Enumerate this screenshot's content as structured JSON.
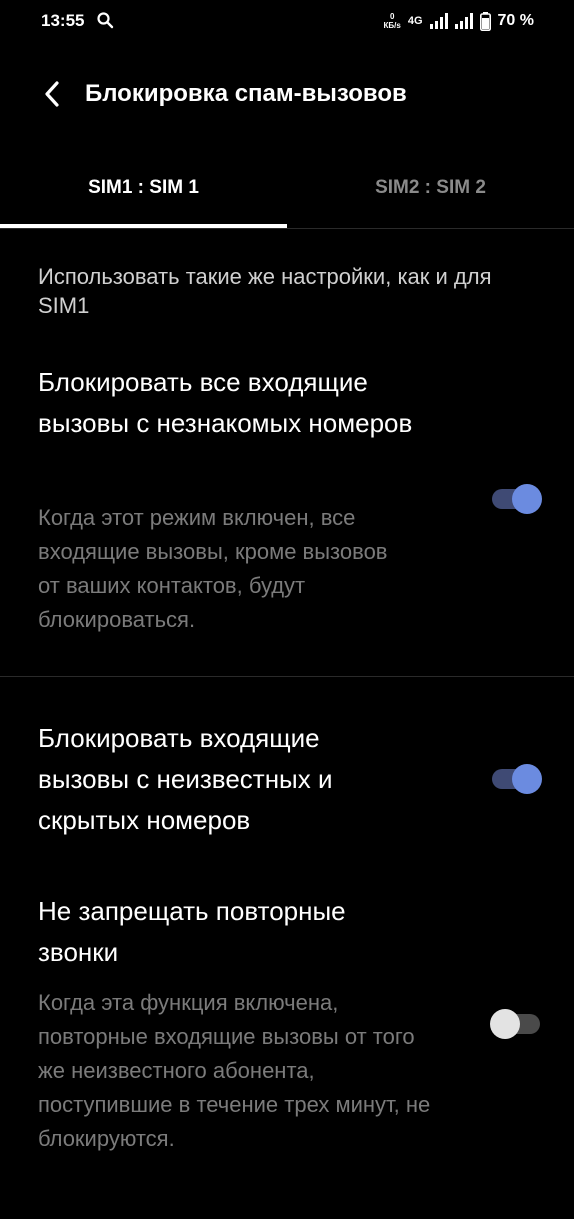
{
  "status_bar": {
    "time": "13:55",
    "speed_value": "0",
    "speed_unit": "КБ/s",
    "network_type": "4G",
    "battery_percent": "70 %"
  },
  "header": {
    "title": "Блокировка спам-вызовов"
  },
  "tabs": [
    {
      "label": "SIM1 : SIM 1",
      "selected": true
    },
    {
      "label": "SIM2 : SIM 2",
      "selected": false
    }
  ],
  "section_header": "Использовать такие же настройки, как и для SIM1",
  "settings": [
    {
      "title": "Блокировать все входящие вызовы с незнакомых номеров",
      "description": "Когда этот режим включен, все входящие вызовы, кроме вызовов от ваших контактов, будут блокироваться.",
      "enabled": true
    },
    {
      "title": "Блокировать входящие вызовы с неизвестных и скрытых номеров",
      "enabled": true
    },
    {
      "title": "Не запрещать повторные звонки",
      "description": "Когда эта функция включена, повторные входящие вызовы от того же неизвестного абонента, поступившие в течение трех минут, не блокируются.",
      "enabled": false
    }
  ],
  "colors": {
    "background": "#000000",
    "accent": "#6b8be0",
    "secondary_text": "#7b7b7b"
  }
}
